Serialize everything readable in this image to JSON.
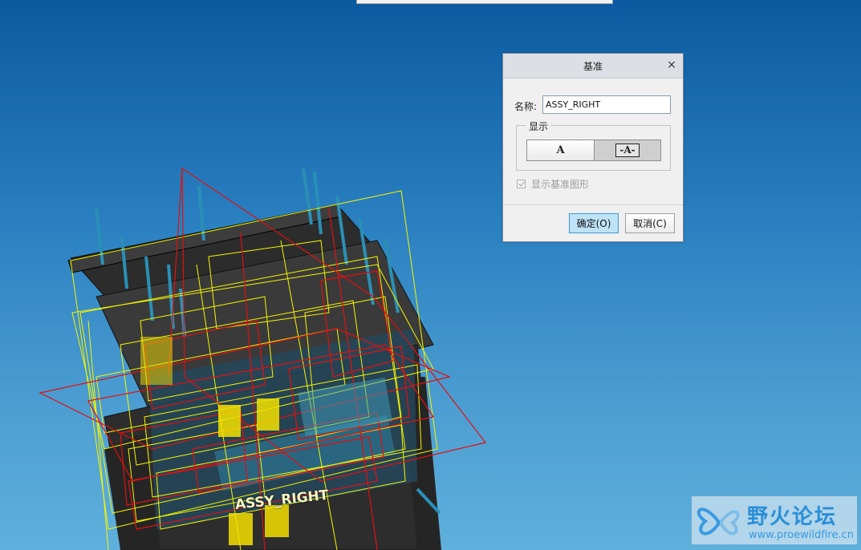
{
  "dialog": {
    "title": "基准",
    "close_glyph": "×",
    "name_label": "名称:",
    "name_value": "ASSY_RIGHT",
    "display_group_label": "显示",
    "display_option_a": "A",
    "display_option_a_line": "-A-",
    "show_datum_graphic_label": "显示基准图形",
    "ok_label": "确定(O)",
    "cancel_label": "取消(C)"
  },
  "viewport": {
    "datum_label": "ASSY_RIGHT"
  },
  "watermark": {
    "title": "野火论坛",
    "url": "www.proewildfire.cn"
  },
  "colors": {
    "background_top": "#0b5aa0",
    "background_bottom": "#5fb0dc",
    "datum_red": "#e01010",
    "datum_yellow": "#f5f500",
    "ok_button": "#bfe3f7"
  }
}
